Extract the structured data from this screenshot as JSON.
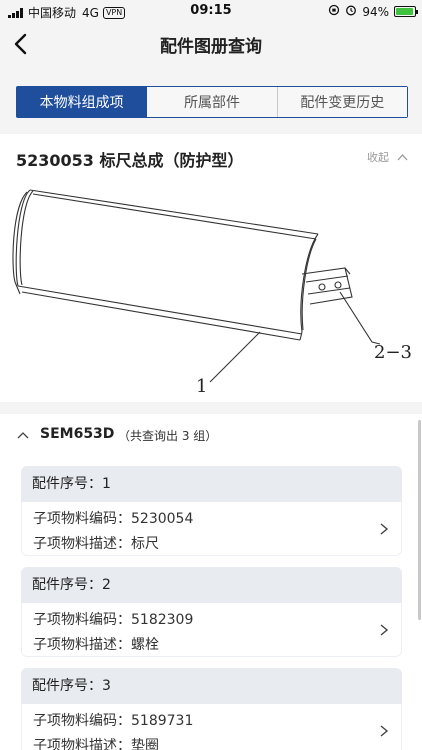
{
  "status": {
    "carrier": "中国移动",
    "network": "4G",
    "vpn": "VPN",
    "time": "09:15",
    "battery": "94%",
    "battery_level": 0.94,
    "battery_color": "#3fc23f"
  },
  "nav": {
    "title": "配件图册查询"
  },
  "tabs": [
    {
      "label": "本物料组成项",
      "active": true
    },
    {
      "label": "所属部件",
      "active": false
    },
    {
      "label": "配件变更历史",
      "active": false
    }
  ],
  "part": {
    "title": "5230053 标尺总成（防护型）",
    "collapse_label": "收起"
  },
  "drawing": {
    "callout_1": "1",
    "callout_2": "2−3"
  },
  "group": {
    "name": "SEM653D",
    "count_text": "（共查询出 3 组）"
  },
  "items": [
    {
      "seq": "配件序号：1",
      "code": "子项物料编码：5230054",
      "desc": "子项物料描述：标尺"
    },
    {
      "seq": "配件序号：2",
      "code": "子项物料编码：5182309",
      "desc": "子项物料描述：螺栓"
    },
    {
      "seq": "配件序号：3",
      "code": "子项物料编码：5189731",
      "desc": "子项物料描述：垫圈"
    }
  ],
  "colors": {
    "accent": "#1f4e9c"
  }
}
